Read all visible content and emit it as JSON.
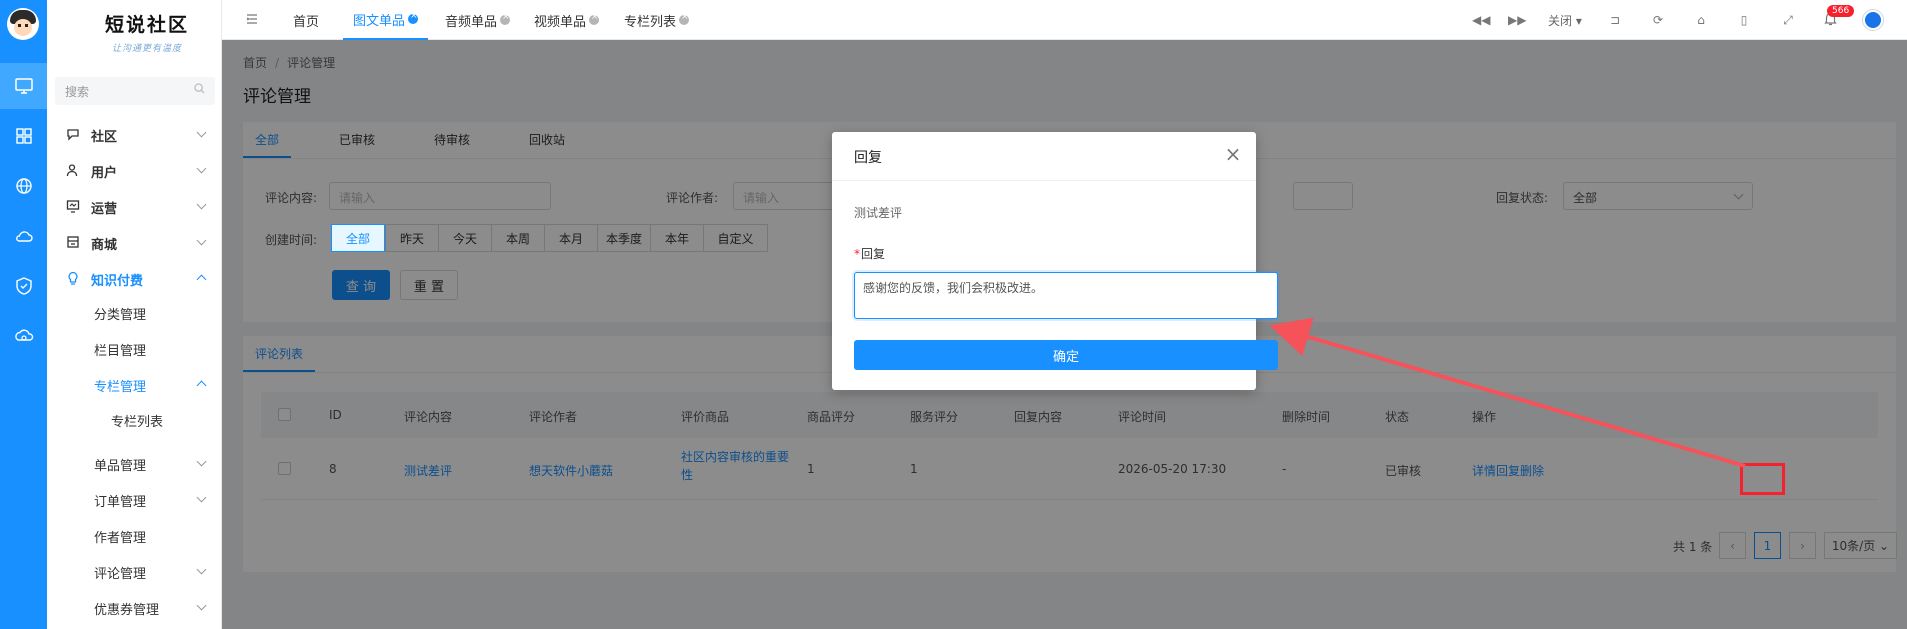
{
  "sidebar": {
    "brand_name": "短说社区",
    "brand_slogan": "让沟通更有温度",
    "search_placeholder": "搜索",
    "items": [
      {
        "label": "社区",
        "icon": "chat-bubble-icon",
        "expanded": false
      },
      {
        "label": "用户",
        "icon": "user-icon",
        "expanded": false
      },
      {
        "label": "运营",
        "icon": "monitor-chart-icon",
        "expanded": false
      },
      {
        "label": "商城",
        "icon": "shop-icon",
        "expanded": false
      },
      {
        "label": "知识付费",
        "icon": "lightbulb-icon",
        "expanded": true,
        "active": true
      }
    ],
    "sub_items": [
      "分类管理",
      "栏目管理",
      "专栏管理",
      "专栏列表",
      "单品管理",
      "订单管理",
      "作者管理",
      "评论管理",
      "优惠券管理"
    ]
  },
  "rail": {
    "icons": [
      "desktop-icon",
      "grid-icon",
      "globe-icon",
      "cloud-icon",
      "shield-check-icon",
      "cloud-sync-icon"
    ]
  },
  "topbar": {
    "tabs": [
      {
        "label": "首页",
        "closable": false
      },
      {
        "label": "图文单品",
        "closable": true,
        "active": true
      },
      {
        "label": "音频单品",
        "closable": true
      },
      {
        "label": "视频单品",
        "closable": true
      },
      {
        "label": "专栏列表",
        "closable": true
      }
    ],
    "close_menu_label": "关闭",
    "notification_count": "566",
    "accent_color": "#1890ff"
  },
  "page": {
    "breadcrumb": [
      "首页",
      "评论管理"
    ],
    "title": "评论管理",
    "tabs": [
      "全部",
      "已审核",
      "待审核",
      "回收站"
    ],
    "filters": {
      "comment_label": "评论内容:",
      "comment_placeholder": "请输入",
      "author_label": "评论作者:",
      "author_placeholder": "请输入",
      "reply_status_label": "回复状态:",
      "reply_status_value": "全部",
      "created_label": "创建时间:",
      "time_options": [
        "全部",
        "昨天",
        "今天",
        "本周",
        "本月",
        "本季度",
        "本年",
        "自定义"
      ],
      "query_button": "查 询",
      "reset_button": "重 置"
    },
    "list_tab": "评论列表",
    "table": {
      "columns": [
        "ID",
        "评论内容",
        "评论作者",
        "评价商品",
        "商品评分",
        "服务评分",
        "回复内容",
        "评论时间",
        "删除时间",
        "状态",
        "操作"
      ],
      "rows": [
        {
          "id": "8",
          "content": "测试差评",
          "author": "想天软件小蘑菇",
          "product_line1": "社区内容审核的重要",
          "product_line2": "性",
          "product_score": "1",
          "service_score": "1",
          "reply": "",
          "time": "2026-05-20 17:30",
          "deleted": "-",
          "status": "已审核",
          "actions": [
            "详情",
            "回复",
            "删除"
          ]
        }
      ]
    },
    "pagination": {
      "total": "共 1 条",
      "current_page": "1",
      "page_size": "10条/页"
    }
  },
  "modal": {
    "title": "回复",
    "comment_text": "测试差评",
    "required_mark": "*",
    "field_label": "回复",
    "reply_value": "感谢您的反馈，我们会积极改进。",
    "confirm_label": "确定"
  }
}
